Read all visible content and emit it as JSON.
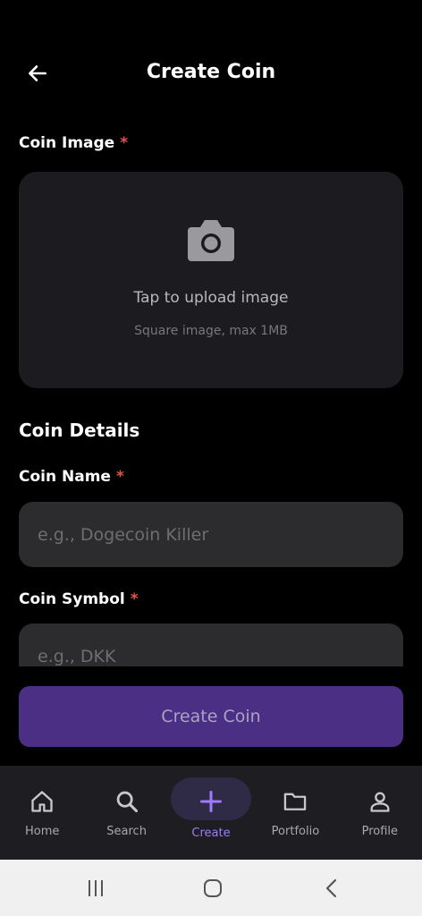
{
  "header": {
    "title": "Create Coin",
    "back_icon": "arrow-left-icon"
  },
  "image_section": {
    "label": "Coin Image",
    "required_mark": "*",
    "upload_text": "Tap to upload image",
    "upload_hint": "Square image, max 1MB",
    "icon": "camera-icon"
  },
  "details": {
    "title": "Coin Details",
    "name_label": "Coin Name",
    "name_placeholder": "e.g., Dogecoin Killer",
    "symbol_label": "Coin Symbol",
    "symbol_placeholder": "e.g., DKK",
    "required_mark": "*"
  },
  "submit": {
    "label": "Create Coin"
  },
  "nav": {
    "items": [
      {
        "label": "Home",
        "icon": "home-icon"
      },
      {
        "label": "Search",
        "icon": "search-icon"
      },
      {
        "label": "Create",
        "icon": "plus-icon"
      },
      {
        "label": "Portfolio",
        "icon": "folder-icon"
      },
      {
        "label": "Profile",
        "icon": "person-icon"
      }
    ],
    "active": "Create"
  },
  "colors": {
    "background": "#000000",
    "card": "#1c1c20",
    "field": "#2c2c2f",
    "button": "#4a2f85",
    "accent": "#9d7cff",
    "required": "#e0544b"
  }
}
